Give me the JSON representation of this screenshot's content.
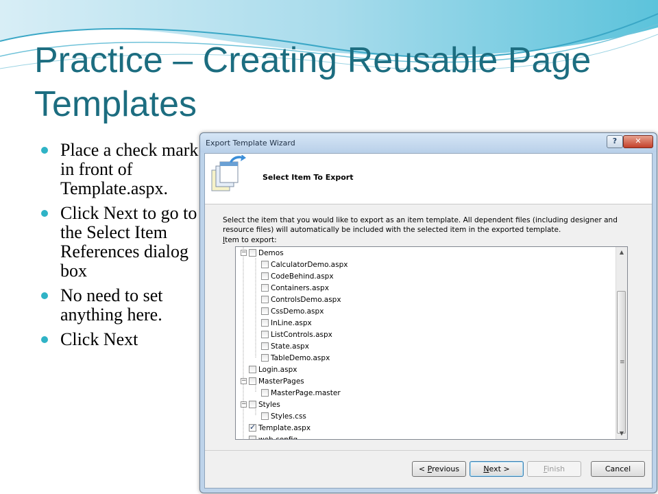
{
  "slide": {
    "title": "Practice – Creating Reusable Page Templates",
    "bullets": [
      "Place a check mark in front of Template.aspx.",
      "Click Next to go to the Select Item References dialog box",
      "No need to set anything here.",
      "Click Next"
    ]
  },
  "dialog": {
    "title": "Export Template Wizard",
    "help_label": "?",
    "close_label": "✕",
    "header_title": "Select Item To Export",
    "description": "Select the item that you would like to export as an item template. All dependent files (including designer and resource files) will automatically be included with the selected item in the exported template.",
    "item_label_hotkey": "I",
    "item_label_rest": "tem to export:",
    "tree": [
      {
        "label": "Demos",
        "level": 0,
        "expander": "−",
        "checked": false
      },
      {
        "label": "CalculatorDemo.aspx",
        "level": 1,
        "checked": false
      },
      {
        "label": "CodeBehind.aspx",
        "level": 1,
        "checked": false
      },
      {
        "label": "Containers.aspx",
        "level": 1,
        "checked": false
      },
      {
        "label": "ControlsDemo.aspx",
        "level": 1,
        "checked": false
      },
      {
        "label": "CssDemo.aspx",
        "level": 1,
        "checked": false
      },
      {
        "label": "InLine.aspx",
        "level": 1,
        "checked": false
      },
      {
        "label": "ListControls.aspx",
        "level": 1,
        "checked": false
      },
      {
        "label": "State.aspx",
        "level": 1,
        "checked": false
      },
      {
        "label": "TableDemo.aspx",
        "level": 1,
        "checked": false
      },
      {
        "label": "Login.aspx",
        "level": 0,
        "checked": false
      },
      {
        "label": "MasterPages",
        "level": 0,
        "expander": "−",
        "checked": false
      },
      {
        "label": "MasterPage.master",
        "level": 1,
        "checked": false
      },
      {
        "label": "Styles",
        "level": 0,
        "expander": "−",
        "checked": false
      },
      {
        "label": "Styles.css",
        "level": 1,
        "checked": false
      },
      {
        "label": "Template.aspx",
        "level": 0,
        "checked": true
      },
      {
        "label": "web.config",
        "level": 0,
        "checked": false
      }
    ],
    "buttons": {
      "previous_prefix": "< ",
      "previous_hotkey": "P",
      "previous_rest": "revious",
      "next_hotkey": "N",
      "next_rest": "ext >",
      "finish_hotkey": "F",
      "finish_rest": "inish",
      "cancel": "Cancel"
    },
    "scroll_up": "▲",
    "scroll_down": "▼",
    "scroll_grip": "≡",
    "check_glyph": "✓"
  }
}
